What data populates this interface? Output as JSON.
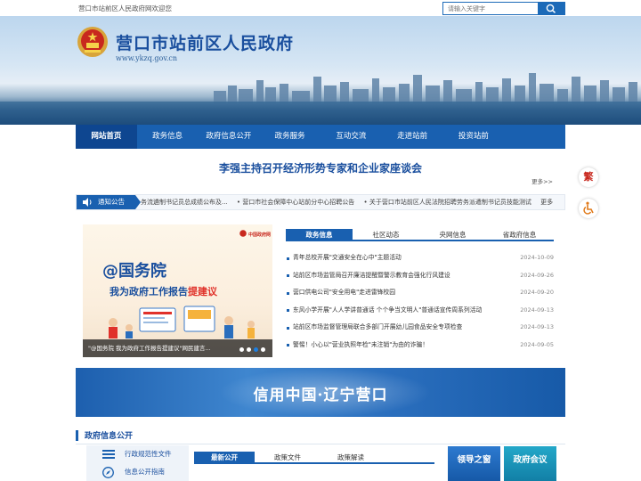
{
  "topbar": {
    "welcome": "营口市站前区人民政府网欢迎您"
  },
  "search": {
    "placeholder": "请输入关键字"
  },
  "header": {
    "title": "营口市站前区人民政府",
    "url": "www.ykzq.gov.cn"
  },
  "nav": [
    "网站首页",
    "政务信息",
    "政府信息公开",
    "政务服务",
    "互动交流",
    "走进站前",
    "投资站前"
  ],
  "headline": {
    "text": "李强主持召开经济形势专家和企业家座谈会",
    "more": "更多>>"
  },
  "notice": {
    "label": "通知公告",
    "items": [
      "务流遴制书记员总成绩公布及...",
      "• 营口市社会保障中心站前分中心招聘公告",
      "• 关于营口市站前区人民法院招聘劳务派遣制书记员技能测试",
      "更多"
    ]
  },
  "news_image": {
    "logo": "中国政府网",
    "headline": "@国务院",
    "subtitle_a": "我为政府工作报告",
    "subtitle_b": "提建议",
    "caption": "\"@国务院 我为政府工作报告提建议\"网民建言..."
  },
  "news_tabs": [
    "政务信息",
    "社区动态",
    "央网信息",
    "省政府信息"
  ],
  "news_list": [
    {
      "title": "青年总校开展\"交通安全在心中\"主题活动",
      "date": "2024-10-09"
    },
    {
      "title": "站前区市场监管局召开廉洁提醒暨警示教育会强化行风建设",
      "date": "2024-09-26"
    },
    {
      "title": "营口供电公司\"安全用电\"走进雷锋校园",
      "date": "2024-09-20"
    },
    {
      "title": "东风小学开展\"人人学讲普通话 个个争当文明人\"普通话宣传周系列活动",
      "date": "2024-09-13"
    },
    {
      "title": "站前区市场监督管理局联合多部门开展幼儿园食品安全专项检查",
      "date": "2024-09-13"
    },
    {
      "title": "警惕！小心以\"营业执照年检\"未注销\"为由的诈骗！",
      "date": "2024-09-05"
    }
  ],
  "credit_banner": "信用中国·辽宁营口",
  "gov_info": {
    "title": "政府信息公开",
    "left_nav": [
      "行政规范性文件",
      "信息公开指南"
    ],
    "tabs": [
      "最新公开",
      "政策文件",
      "政策解读"
    ],
    "leader_button": "领导之窗",
    "meeting_button": "政府会议"
  },
  "float": {
    "traditional": "繁"
  },
  "colors": {
    "primary": "#1960b0",
    "accent_red": "#c8281e"
  }
}
